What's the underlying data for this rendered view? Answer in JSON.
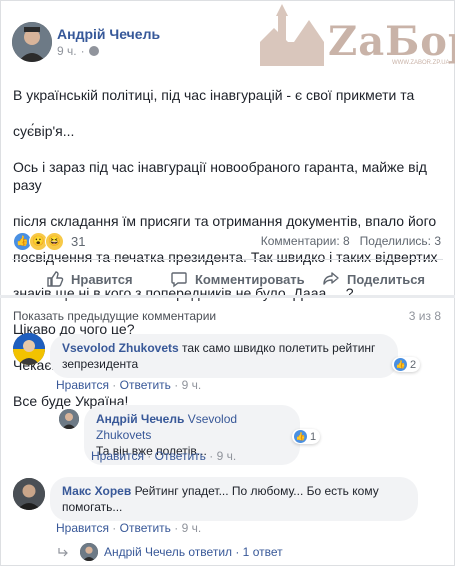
{
  "post": {
    "author": "Андрій Чечель",
    "time": "9 ч.",
    "text_lines": [
      "В українській політиці, під час інавгурацій - є свої прикмети та",
      "сує́вір'я...",
      "Ось і зараз під час інавгурації новообраного гаранта, майже від разу",
      "після складання їм присяги та отримання документів, впало його",
      "посвідчення та печатка президента. Так швидко і таких відвертих",
      "знаків ще ні в кого з попередників не було. Дааа.... ?",
      "Цікаво до чого це?",
      "Чекаємо...",
      "Все буде Україна!"
    ],
    "reaction_count": "31",
    "comments_count": "Комментарии: 8",
    "shares_count": "Поделились: 3"
  },
  "watermark": {
    "text": "ZaБор",
    "site": "WWW.ZABOR.ZP.UA"
  },
  "actions": {
    "like": "Нравится",
    "comment": "Комментировать",
    "share": "Поделиться"
  },
  "comments_header": {
    "show_previous": "Показать предыдущие комментарии",
    "pager": "3 из 8"
  },
  "comments": [
    {
      "author": "Vsevolod Zhukovets",
      "text": "так само швидко полетить рейтинг зепрезидента",
      "likes": "2",
      "like_label": "Нравится",
      "reply_label": "Ответить",
      "time": "9 ч."
    },
    {
      "author": "Андрій Чечель",
      "mention": "Vsevolod Zhukovets",
      "text": "Та він вже полетів...",
      "likes": "1",
      "like_label": "Нравится",
      "reply_label": "Ответить",
      "time": "9 ч."
    },
    {
      "author": "Макс Хорев",
      "text": "Рейтинг упадет... По любому... Бо есть кому помогать...",
      "like_label": "Нравится",
      "reply_label": "Ответить",
      "time": "9 ч.",
      "replied_text": "Андрій Чечель ответил · 1 ответ"
    }
  ],
  "colors": {
    "link": "#385898",
    "author_link": "#365899",
    "secondary": "#90949c",
    "like_blue": "#4a90e2",
    "bubble_bg": "#f2f3f5",
    "watermark": "#c9b3a8"
  }
}
